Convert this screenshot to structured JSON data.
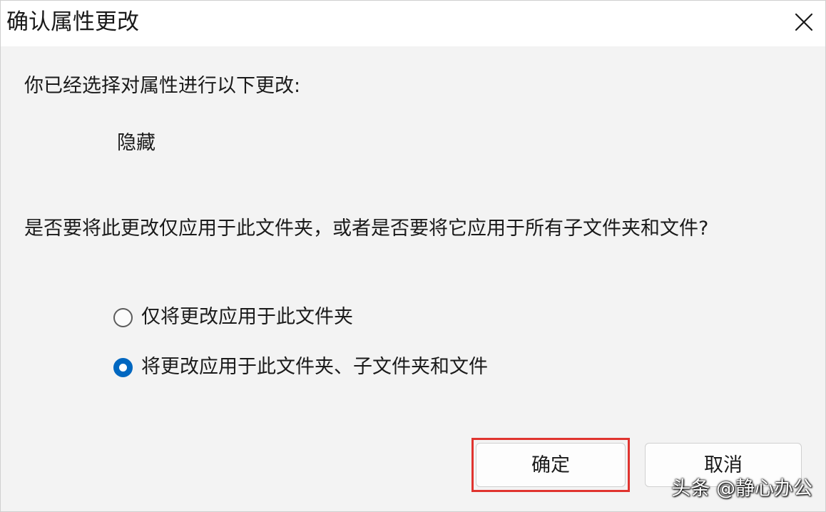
{
  "dialog": {
    "title": "确认属性更改",
    "close_icon": "close-icon"
  },
  "content": {
    "intro": "你已经选择对属性进行以下更改:",
    "change": "隐藏",
    "question": "是否要将此更改仅应用于此文件夹，或者是否要将它应用于所有子文件夹和文件?"
  },
  "options": [
    {
      "label": "仅将更改应用于此文件夹",
      "selected": false
    },
    {
      "label": "将更改应用于此文件夹、子文件夹和文件",
      "selected": true
    }
  ],
  "buttons": {
    "ok": "确定",
    "cancel": "取消"
  },
  "watermark": "头条 @静心办公",
  "colors": {
    "accent": "#0067c0",
    "highlight": "#e0342f"
  }
}
